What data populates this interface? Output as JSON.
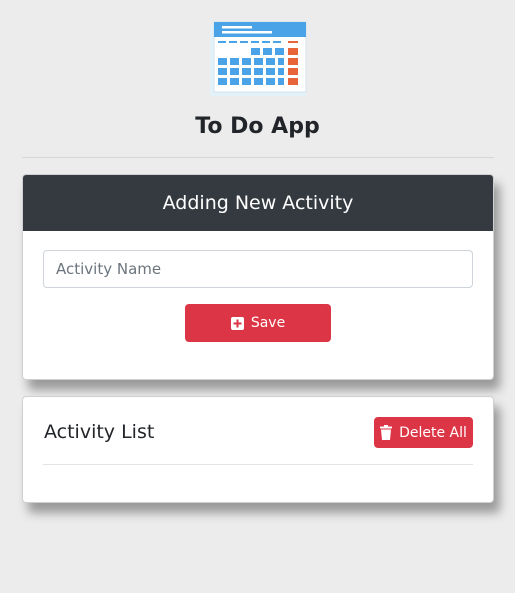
{
  "header": {
    "app_title": "To Do App",
    "logo_icon": "calendar-icon"
  },
  "add_activity": {
    "title": "Adding New Activity",
    "input": {
      "placeholder": "Activity Name",
      "value": ""
    },
    "save_button": {
      "label": "Save",
      "icon": "plus-square-icon"
    }
  },
  "activity_list": {
    "title": "Activity List",
    "items": [],
    "delete_all_button": {
      "label": "Delete All",
      "icon": "trash-icon"
    }
  },
  "colors": {
    "background": "#ececec",
    "header_dark": "#343a40",
    "danger": "#dc3545"
  }
}
